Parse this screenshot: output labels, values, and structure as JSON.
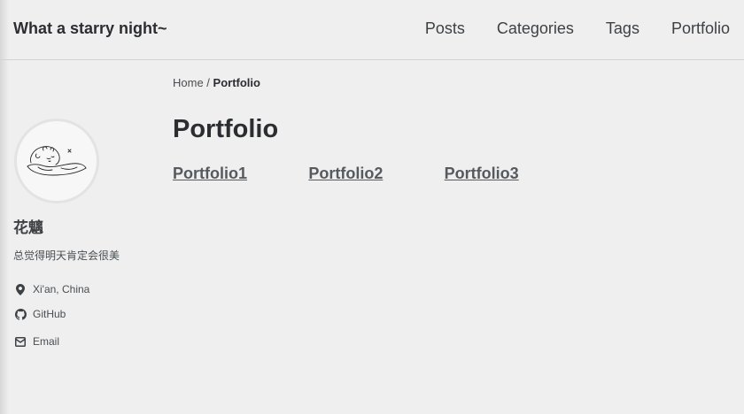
{
  "header": {
    "site_title": "What a starry night~",
    "nav": [
      "Posts",
      "Categories",
      "Tags",
      "Portfolio"
    ]
  },
  "sidebar": {
    "author_name": "花魑",
    "bio": "总觉得明天肯定会很美",
    "links": {
      "location": "Xi'an, China",
      "github": "GitHub",
      "email": "Email"
    }
  },
  "breadcrumb": {
    "home": "Home",
    "separator": " / ",
    "current": "Portfolio"
  },
  "main": {
    "title": "Portfolio",
    "items": [
      "Portfolio1",
      "Portfolio2",
      "Portfolio3"
    ]
  },
  "icons": {
    "location": "map-marker-icon",
    "github": "github-icon",
    "email": "envelope-icon"
  }
}
